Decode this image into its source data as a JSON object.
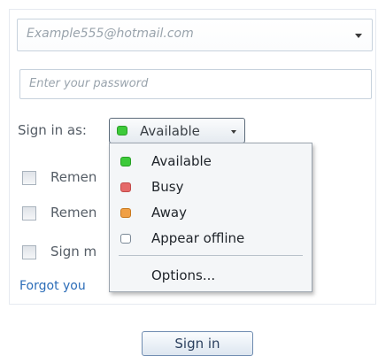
{
  "login": {
    "email_value": "Example555@hotmail.com",
    "password_placeholder": "Enter your password",
    "sign_in_as_label": "Sign in as:",
    "current_status": "Available",
    "checkboxes": [
      {
        "label": "Remen",
        "checked": false
      },
      {
        "label": "Remen",
        "checked": false
      },
      {
        "label": "Sign m",
        "checked": false
      }
    ],
    "forgot_link": "Forgot you",
    "sign_in_button": "Sign in"
  },
  "status_menu": {
    "items": [
      {
        "label": "Available",
        "icon": "status-available-icon",
        "color": "#3dca3a"
      },
      {
        "label": "Busy",
        "icon": "status-busy-icon",
        "color": "#e56a6a"
      },
      {
        "label": "Away",
        "icon": "status-away-icon",
        "color": "#f0a045"
      },
      {
        "label": "Appear offline",
        "icon": "status-offline-icon",
        "color": "#ffffff"
      }
    ],
    "options_label": "Options..."
  }
}
